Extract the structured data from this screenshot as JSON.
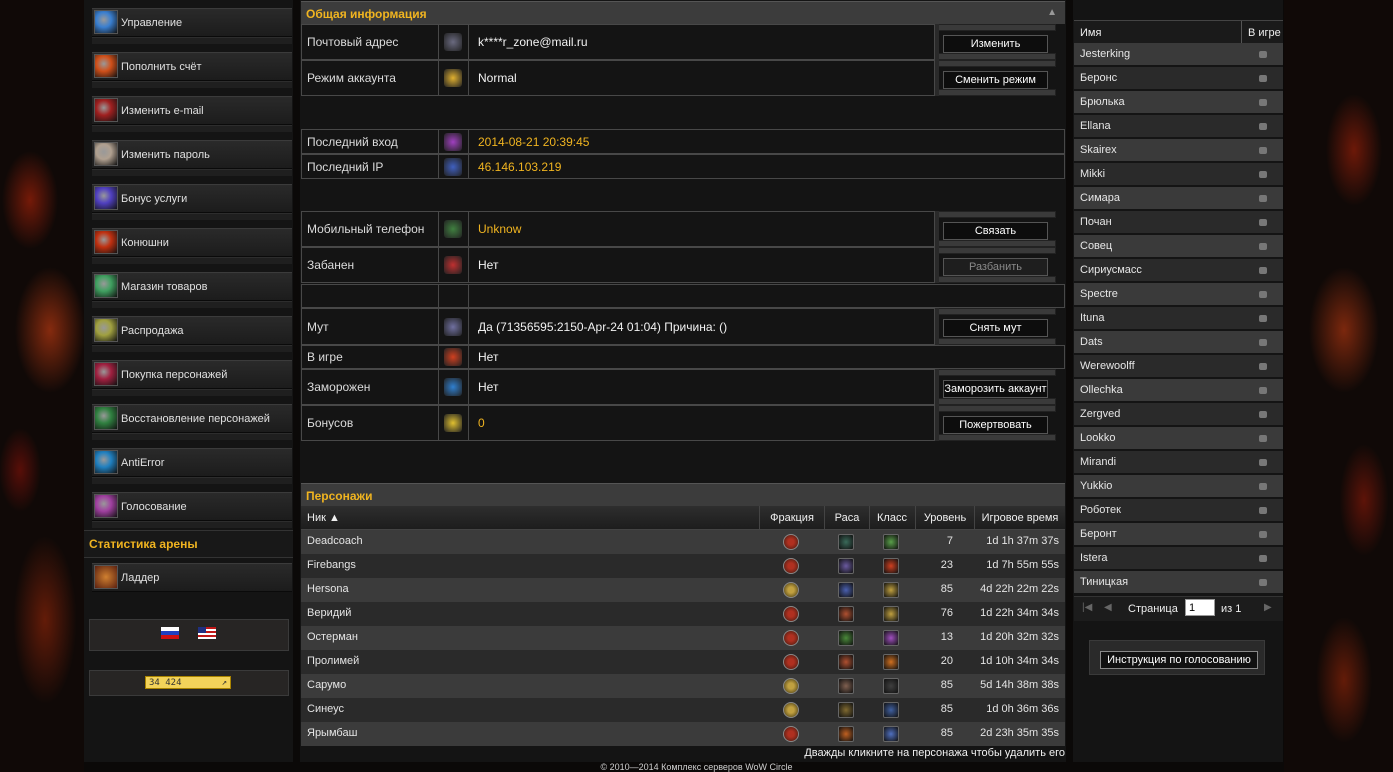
{
  "menu": [
    {
      "label": "Управление",
      "icon": "control-icon",
      "color": "#3a7fd0"
    },
    {
      "label": "Пополнить счёт",
      "icon": "fire-icon",
      "color": "#d0501a"
    },
    {
      "label": "Изменить e-mail",
      "icon": "demon-icon",
      "color": "#a02020"
    },
    {
      "label": "Изменить пароль",
      "icon": "face-icon",
      "color": "#b0a090"
    },
    {
      "label": "Бонус услуги",
      "icon": "slash-icon",
      "color": "#5040c0"
    },
    {
      "label": "Конюшни",
      "icon": "dragon-icon",
      "color": "#c03010"
    },
    {
      "label": "Магазин товаров",
      "icon": "orb-icon",
      "color": "#40a060"
    },
    {
      "label": "Распродажа",
      "icon": "totem-icon",
      "color": "#a0a040"
    },
    {
      "label": "Покупка персонажей",
      "icon": "beast-icon",
      "color": "#a02040"
    },
    {
      "label": "Восстановление персонажей",
      "icon": "nature-icon",
      "color": "#308040"
    },
    {
      "label": "AntiError",
      "icon": "swirl-icon",
      "color": "#2080c0"
    },
    {
      "label": "Голосование",
      "icon": "vote-icon",
      "color": "#a040a0"
    }
  ],
  "arena": {
    "title": "Статистика арены",
    "ladder_label": "Ладдер",
    "ladder_icon": "ladder-icon"
  },
  "counter": {
    "text": "34 424"
  },
  "info": {
    "title": "Общая информация",
    "rows": [
      {
        "key": "Почтовый адрес",
        "value": "k****r_zone@mail.ru",
        "icon": "mail-icon",
        "color": "white",
        "button": "Изменить"
      },
      {
        "key": "Режим аккаунта",
        "value": "Normal",
        "icon": "star-icon",
        "color": "white",
        "button": "Сменить режим"
      },
      {
        "key": "Последний вход",
        "value": "2014-08-21 20:39:45",
        "icon": "login-icon",
        "color": "gold"
      },
      {
        "key": "Последний IP",
        "value": "46.146.103.219",
        "icon": "ip-icon",
        "color": "gold"
      },
      {
        "key": "Мобильный телефон",
        "value": "Unknow",
        "icon": "phone-icon",
        "color": "gold",
        "button": "Связать"
      },
      {
        "key": "Забанен",
        "value": "Нет",
        "icon": "ban-icon",
        "color": "white",
        "button": "Разбанить"
      },
      {
        "key": "",
        "value": "",
        "icon": "",
        "color": "white"
      },
      {
        "key": "Мут",
        "value": "Да (71356595:2150-Apr-24 01:04) Причина: ()",
        "icon": "mute-icon",
        "color": "white",
        "button": "Снять мут"
      },
      {
        "key": "В игре",
        "value": "Нет",
        "icon": "ingame-icon",
        "color": "white"
      },
      {
        "key": "Заморожен",
        "value": "Нет",
        "icon": "frozen-icon",
        "color": "white",
        "button": "Заморозить аккаунт"
      },
      {
        "key": "Бонусов",
        "value": "0",
        "icon": "coin-icon",
        "color": "gold",
        "button": "Пожертвовать"
      }
    ]
  },
  "characters": {
    "title": "Персонажи",
    "columns": [
      "Ник ▲",
      "Фракция",
      "Раса",
      "Класс",
      "Уровень",
      "Игровое время"
    ],
    "rows": [
      {
        "nick": "Deadcoach",
        "faction": "horde",
        "race_color": "#3a6a5a",
        "class_color": "#5aa04a",
        "level": "7",
        "time": "1d 1h 37m 37s"
      },
      {
        "nick": "Firebangs",
        "faction": "horde",
        "race_color": "#6a5aa0",
        "class_color": "#d04020",
        "level": "23",
        "time": "1d 7h 55m 55s"
      },
      {
        "nick": "Hersona",
        "faction": "alliance",
        "race_color": "#4a60b0",
        "class_color": "#c0a040",
        "level": "85",
        "time": "4d 22h 22m 22s"
      },
      {
        "nick": "Веридий",
        "faction": "horde",
        "race_color": "#b05030",
        "class_color": "#c0a040",
        "level": "76",
        "time": "1d 22h 34m 34s"
      },
      {
        "nick": "Остерман",
        "faction": "horde",
        "race_color": "#4a8a3a",
        "class_color": "#a050c0",
        "level": "13",
        "time": "1d 20h 32m 32s"
      },
      {
        "nick": "Пролимей",
        "faction": "horde",
        "race_color": "#b05030",
        "class_color": "#d07020",
        "level": "20",
        "time": "1d 10h 34m 34s"
      },
      {
        "nick": "Сарумо",
        "faction": "alliance",
        "race_color": "#806050",
        "class_color": "#404040",
        "level": "85",
        "time": "5d 14h 38m 38s"
      },
      {
        "nick": "Синеус",
        "faction": "alliance",
        "race_color": "#806a30",
        "class_color": "#4060a0",
        "level": "85",
        "time": "1d 0h 36m 36s"
      },
      {
        "nick": "Ярымбаш",
        "faction": "horde",
        "race_color": "#c06020",
        "class_color": "#5070c0",
        "level": "85",
        "time": "2d 23h 35m 35s"
      }
    ],
    "hint": "Дважды кликните на персонажа чтобы удалить его"
  },
  "players": {
    "columns": [
      "Имя",
      "В игре"
    ],
    "names": [
      "Jesterking",
      "Беронс",
      "Брюлька",
      "Ellana",
      "Skairex",
      "Mikki",
      "Симара",
      "Почан",
      "Совец",
      "Сириусмасс",
      "Spectre",
      "Ituna",
      "Dats",
      "Werewoolff",
      "Ollechka",
      "Zergved",
      "Lookko",
      "Mirandi",
      "Yukkio",
      "Роботек",
      "Беронт",
      "Istera",
      "Тиницкая"
    ],
    "pager": {
      "page_label": "Страница",
      "page_value": "1",
      "of_label": "из 1"
    }
  },
  "vote_button": "Инструкция по голосованию",
  "footer": "© 2010—2014 Комплекс серверов WoW Circle"
}
